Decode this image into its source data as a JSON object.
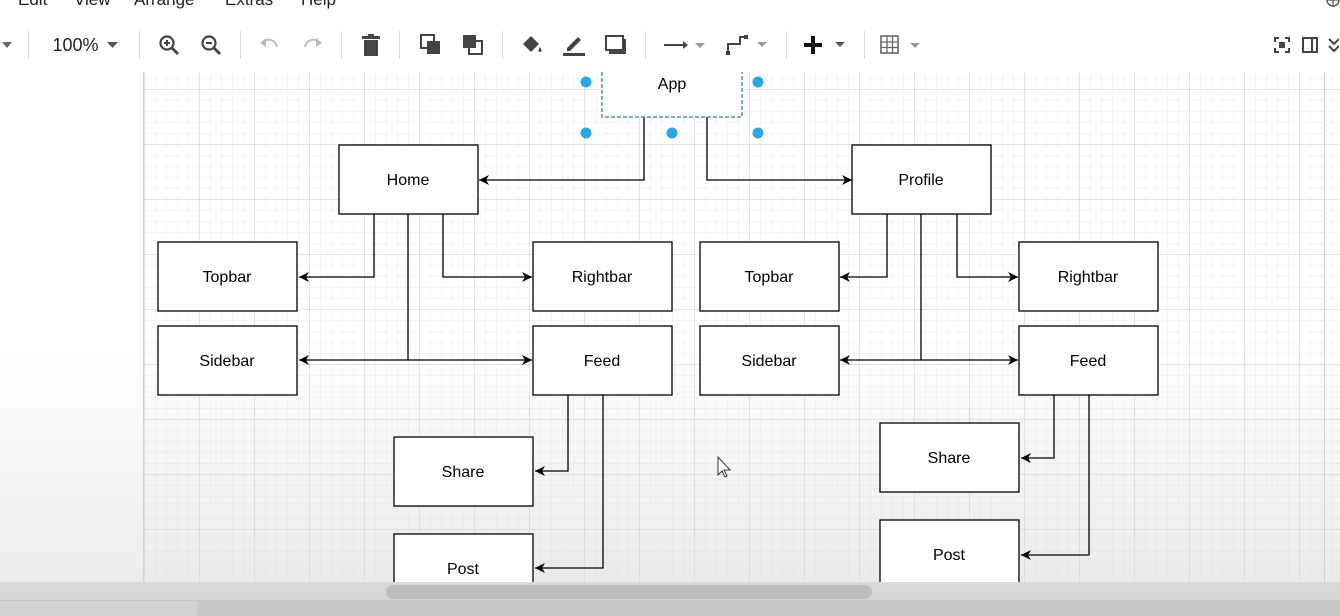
{
  "menu": {
    "items": [
      "Edit",
      "View",
      "Arrange",
      "Extras",
      "Help"
    ]
  },
  "toolbar": {
    "zoom": "100%",
    "icons": [
      "zoom-in-icon",
      "zoom-out-icon",
      "undo-icon",
      "redo-icon",
      "delete-icon",
      "to-front-icon",
      "to-back-icon",
      "fill-color-icon",
      "line-color-icon",
      "shadow-icon",
      "connection-icon",
      "waypoints-icon",
      "insert-icon",
      "table-icon",
      "fit-icon",
      "format-panel-icon",
      "collapse-icon"
    ]
  },
  "diagram": {
    "nodes": {
      "app": "App",
      "home": "Home",
      "profile": "Profile",
      "home_topbar": "Topbar",
      "home_rightbar": "Rightbar",
      "home_sidebar": "Sidebar",
      "home_feed": "Feed",
      "home_share": "Share",
      "home_post": "Post",
      "profile_topbar": "Topbar",
      "profile_rightbar": "Rightbar",
      "profile_sidebar": "Sidebar",
      "profile_feed": "Feed",
      "profile_share": "Share",
      "profile_post": "Post"
    },
    "selected": "app",
    "colors": {
      "selection": "#29a8e8",
      "stroke": "#000000"
    }
  }
}
